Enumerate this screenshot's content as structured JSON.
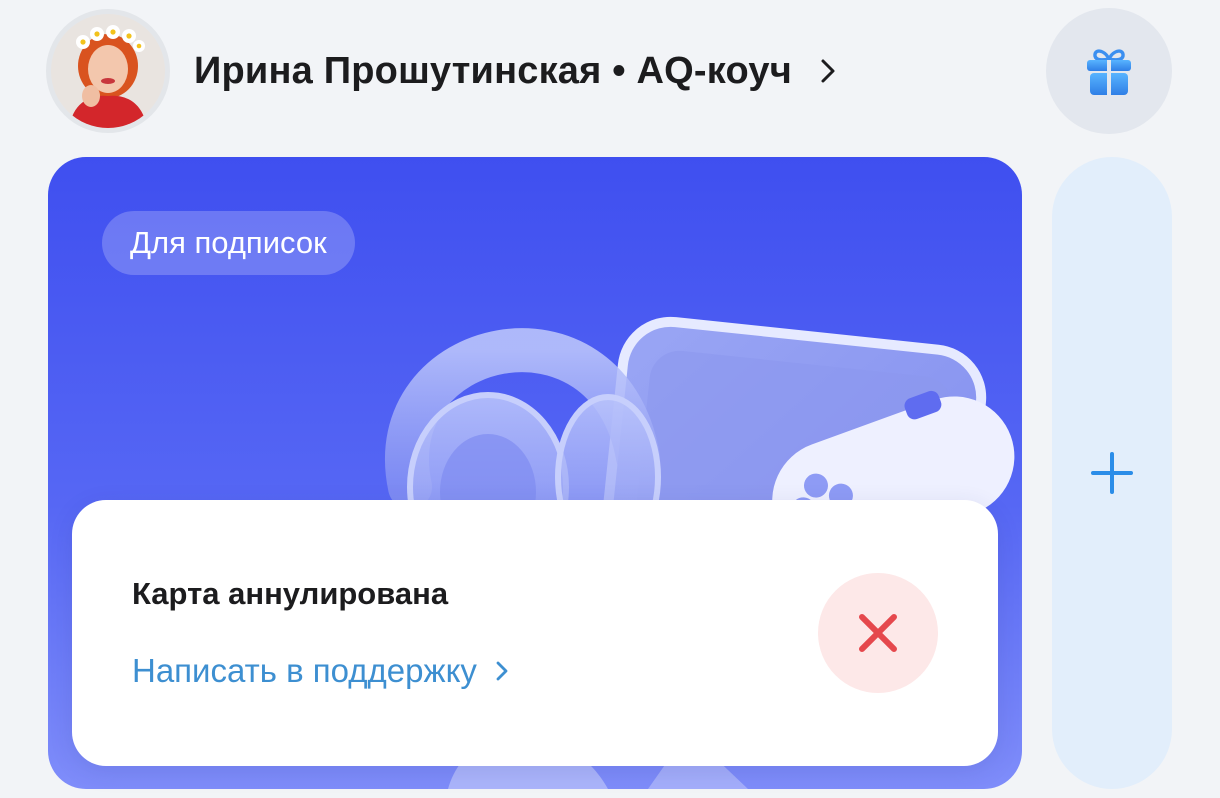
{
  "profile": {
    "name": "Ирина Прошутинская • AQ-коуч"
  },
  "card": {
    "badge": "Для подписок",
    "status_title": "Карта аннулирована",
    "support_link": "Написать в поддержку"
  },
  "icons": {
    "profile_chevron": "chevron-right-icon",
    "gift": "gift-icon",
    "status": "close-icon",
    "add": "plus-icon"
  },
  "colors": {
    "card_gradient_top": "#3f4ff0",
    "card_gradient_bottom": "#7f8dfa",
    "link": "#3d8fd1",
    "error": "#e5484d",
    "error_bg": "#fde8e8",
    "accent": "#2b8de8"
  }
}
